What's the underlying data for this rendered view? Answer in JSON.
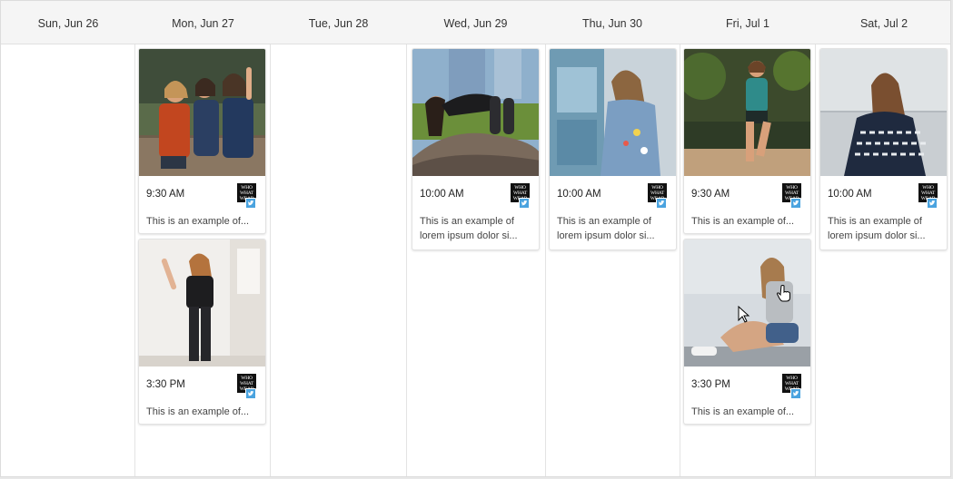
{
  "days": [
    "Sun, Jun 26",
    "Mon, Jun 27",
    "Tue, Jun 28",
    "Wed, Jun 29",
    "Thu, Jun 30",
    "Fri, Jul 1",
    "Sat, Jul 2"
  ],
  "brand_text": "WHO WHAT WEAR",
  "posts": [
    {
      "day": "Mon, Jun 27",
      "time": "9:30 AM",
      "caption": "This is an example of..."
    },
    {
      "day": "Mon, Jun 27",
      "time": "3:30 PM",
      "caption": "This is an example of..."
    },
    {
      "day": "Wed, Jun 29",
      "time": "10:00 AM",
      "caption": "This is an example of lorem ipsum dolor si..."
    },
    {
      "day": "Thu, Jun 30",
      "time": "10:00 AM",
      "caption": "This is an example of lorem ipsum dolor si..."
    },
    {
      "day": "Fri, Jul 1",
      "time": "9:30 AM",
      "caption": "This is an example of..."
    },
    {
      "day": "Fri, Jul 1",
      "time": "3:30 PM",
      "caption": "This is an example of..."
    },
    {
      "day": "Sat, Jul 2",
      "time": "10:00 AM",
      "caption": "This is an example of lorem ipsum dolor si..."
    }
  ],
  "colors": {
    "header_bg": "#f5f5f5",
    "twitter": "#4aa3df",
    "border": "#e3e3e3"
  }
}
